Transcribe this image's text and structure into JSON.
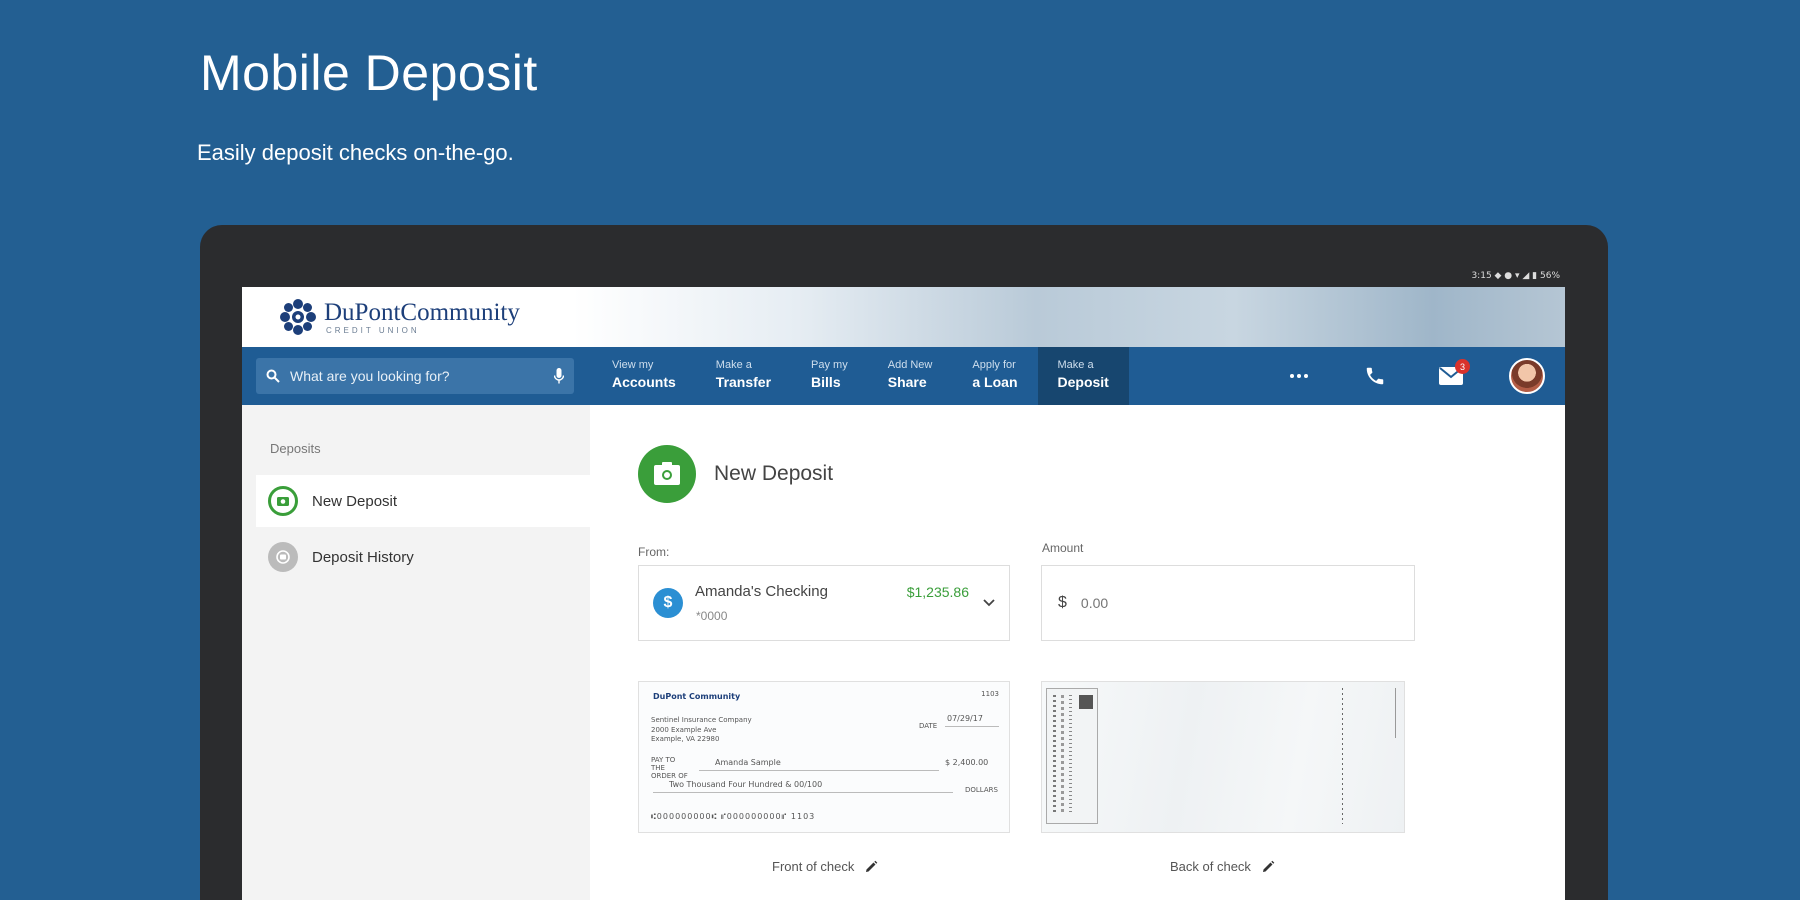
{
  "promo": {
    "title": "Mobile Deposit",
    "subtitle": "Easily deposit checks on-the-go."
  },
  "device": {
    "statusbar": "3:15 ◆ ● ▾ ◢ ▮ 56%"
  },
  "brand": {
    "name_part1": "DuPont",
    "name_part2": "Community",
    "tagline": "CREDIT UNION"
  },
  "search": {
    "placeholder": "What are you looking for?"
  },
  "nav": {
    "items": [
      {
        "top": "View my",
        "bottom": "Accounts"
      },
      {
        "top": "Make a",
        "bottom": "Transfer"
      },
      {
        "top": "Pay my",
        "bottom": "Bills"
      },
      {
        "top": "Add New",
        "bottom": "Share"
      },
      {
        "top": "Apply for",
        "bottom": "a Loan"
      },
      {
        "top": "Make a",
        "bottom": "Deposit"
      }
    ],
    "active_index": 5,
    "messages_badge": "3"
  },
  "sidebar": {
    "heading": "Deposits",
    "items": [
      {
        "label": "New Deposit",
        "active": true
      },
      {
        "label": "Deposit History",
        "active": false
      }
    ]
  },
  "deposit": {
    "title": "New Deposit",
    "from_label": "From:",
    "amount_label": "Amount",
    "account": {
      "name": "Amanda's Checking",
      "number": "*0000",
      "balance": "$1,235.86"
    },
    "currency_symbol": "$",
    "amount_placeholder": "0.00",
    "front_caption": "Front of check",
    "back_caption": "Back of check"
  },
  "check": {
    "bank": "DuPont Community",
    "number": "1103",
    "payer_line1": "Sentinel Insurance Company",
    "payer_line2": "2000 Example Ave",
    "payer_line3": "Example, VA 22980",
    "date_label": "DATE",
    "date": "07/29/17",
    "payee_label": "PAY TO THE ORDER OF",
    "payee": "Amanda Sample",
    "amount": "$ 2,400.00",
    "written_amount": "Two Thousand Four Hundred & 00/100",
    "dollars": "DOLLARS",
    "micr": "⑆000000000⑆  ⑈000000000⑈  1103"
  },
  "colors": {
    "page_bg": "#235f92",
    "nav_bg": "#1f5c94",
    "nav_active": "#17466f",
    "accent_green": "#3a9e3a",
    "badge_red": "#d9322b",
    "account_blue": "#2b8fd3"
  }
}
